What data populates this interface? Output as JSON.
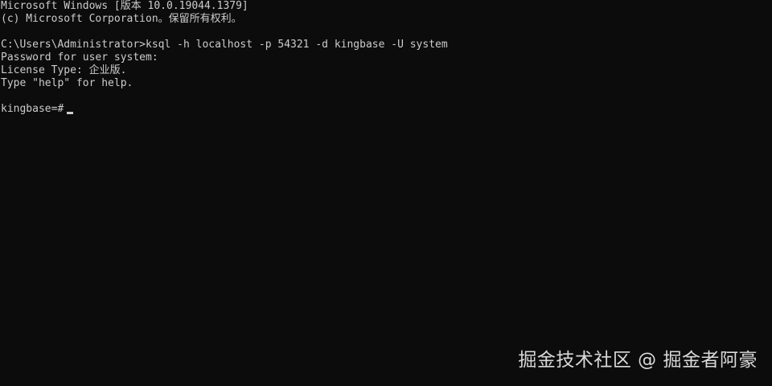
{
  "terminal": {
    "lines": [
      "Microsoft Windows [版本 10.0.19044.1379]",
      "(c) Microsoft Corporation。保留所有权利。",
      "",
      "C:\\Users\\Administrator>ksql -h localhost -p 54321 -d kingbase -U system",
      "Password for user system:",
      "License Type: 企业版.",
      "Type \"help\" for help.",
      "",
      "kingbase=#"
    ],
    "colors": {
      "background": "#0c0c0c",
      "text": "#cccccc"
    }
  },
  "watermark": {
    "text": "掘金技术社区 @ 掘金者阿豪"
  }
}
